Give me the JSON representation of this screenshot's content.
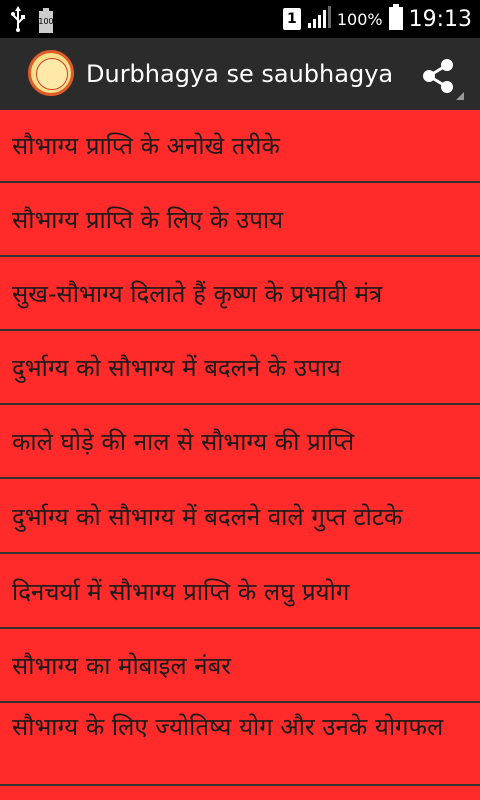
{
  "status_bar": {
    "usb_icon": "usb-icon",
    "battery_notify_icon": "battery-100-icon",
    "battery_notify_text": "100",
    "sim_label": "1",
    "signal_icon": "signal-icon",
    "battery_percent": "100%",
    "battery_icon": "battery-icon",
    "time": "19:13"
  },
  "app_bar": {
    "title": "Durbhagya se saubhagya",
    "app_icon": "app-logo-icon",
    "share_icon": "share-icon",
    "overflow_indicator": "overflow-corner"
  },
  "list": {
    "items": [
      {
        "label": "सौभाग्य प्राप्ति के अनोखे तरीके"
      },
      {
        "label": "सौभाग्य प्राप्ति के लिए के उपाय"
      },
      {
        "label": "सुख-सौभाग्य दिलाते हैं कृष्ण के प्रभावी मंत्र"
      },
      {
        "label": "दुर्भाग्य को सौभाग्य में बदलने के उपाय"
      },
      {
        "label": "काले घोड़े की नाल से सौभाग्य की प्राप्ति"
      },
      {
        "label": "दुर्भाग्य को सौभाग्य में बदलने वाले गुप्त टोटके"
      },
      {
        "label": "दिनचर्या में सौभाग्य प्राप्ति के लघु प्रयोग"
      },
      {
        "label": "सौभाग्य का मोबाइल नंबर"
      },
      {
        "label": "सौभाग्य के लिए ज्योतिष्य योग और उनके योगफल"
      }
    ]
  },
  "colors": {
    "status_bar_bg": "#000000",
    "app_bar_bg": "#2b2b2b",
    "list_bg": "#ff2a2a",
    "divider": "#333333",
    "text": "#1a1a1a"
  }
}
